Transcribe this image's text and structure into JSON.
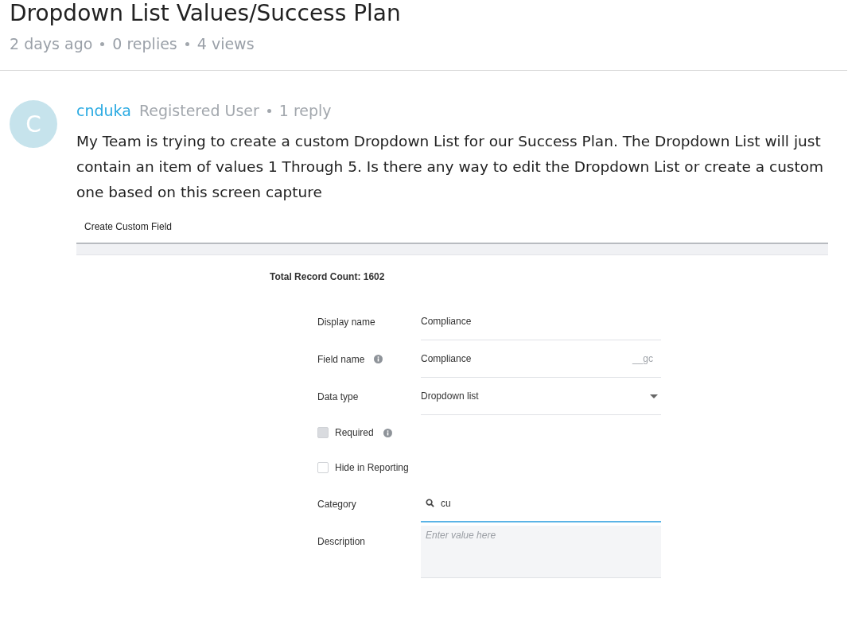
{
  "thread": {
    "title": "Dropdown List Values/Success Plan",
    "meta": [
      "2 days ago",
      "0 replies",
      "4 views"
    ]
  },
  "post": {
    "avatar_letter": "C",
    "author": "cnduka",
    "role": "Registered User",
    "reply_count": "1 reply",
    "body": "My Team is trying to create a custom Dropdown List for our Success Plan. The Dropdown List will just contain an item of values 1 Through 5. Is there any way to edit the Dropdown List or create a custom one based on this screen capture"
  },
  "screenshot": {
    "header": "Create Custom Field",
    "record_count": "Total Record Count: 1602",
    "fields": [
      {
        "kind": "text",
        "label": "Display name",
        "info": false,
        "value": "Compliance"
      },
      {
        "kind": "text",
        "label": "Field name",
        "info": true,
        "value": "Compliance",
        "suffix": "__gc"
      },
      {
        "kind": "select",
        "label": "Data type",
        "info": false,
        "value": "Dropdown list"
      },
      {
        "kind": "checkbox",
        "label": "Required",
        "info": true,
        "checked": false,
        "disabled": true
      },
      {
        "kind": "checkbox",
        "label": "Hide in Reporting",
        "info": false,
        "checked": false,
        "disabled": false
      },
      {
        "kind": "search",
        "label": "Category",
        "info": false,
        "value": "cu",
        "focused": true
      },
      {
        "kind": "textarea",
        "label": "Description",
        "info": false,
        "placeholder": "Enter value here"
      }
    ]
  }
}
